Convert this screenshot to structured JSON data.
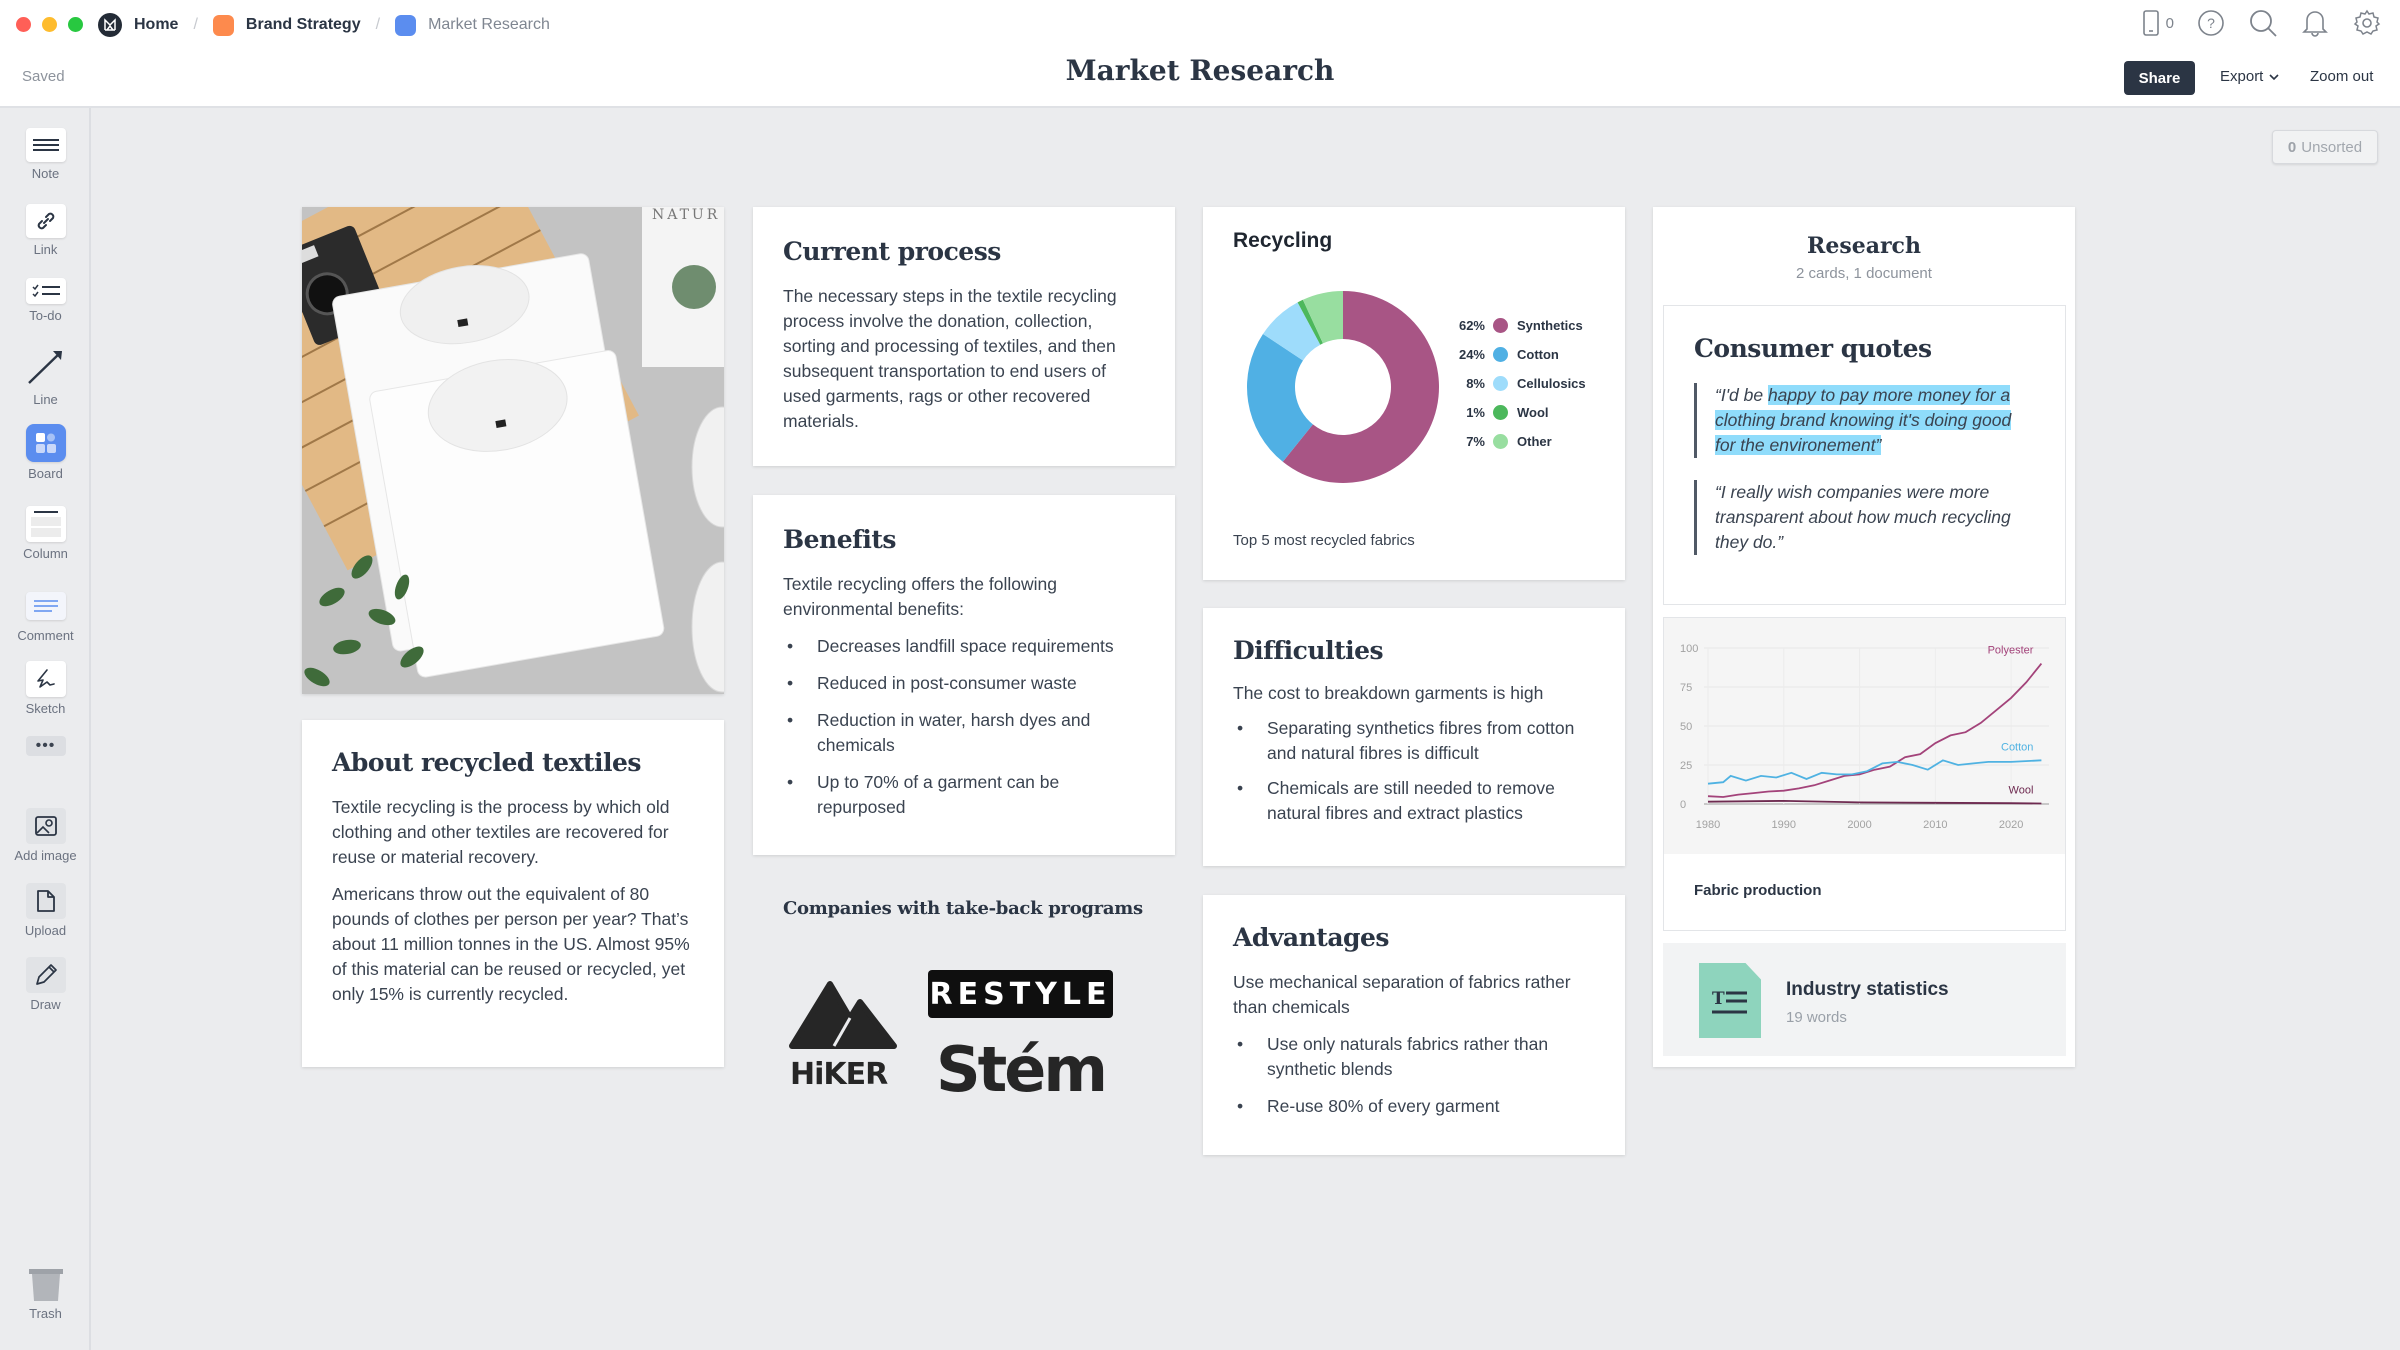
{
  "window": {
    "traffic_lights": {
      "close": "#ff5f57",
      "minimize": "#febc2e",
      "maximize": "#28c840"
    }
  },
  "breadcrumb": [
    {
      "label": "Home",
      "icon": "milanote-logo-icon",
      "color": "#232b36"
    },
    {
      "label": "Brand Strategy",
      "icon": "board-icon",
      "color": "#fd8a4d"
    },
    {
      "label": "Market Research",
      "icon": "board-icon",
      "color": "#5b8def"
    }
  ],
  "header": {
    "status": "Saved",
    "title": "Market Research",
    "device_count": "0",
    "share_label": "Share",
    "export_label": "Export",
    "zoom_label": "Zoom out",
    "icons": [
      "mobile-device-icon",
      "help-icon",
      "search-icon",
      "bell-icon",
      "settings-gear-icon"
    ]
  },
  "sidebar": {
    "tools": [
      {
        "label": "Note",
        "icon": "note-icon"
      },
      {
        "label": "Link",
        "icon": "link-icon"
      },
      {
        "label": "To-do",
        "icon": "todo-icon"
      },
      {
        "label": "Line",
        "icon": "line-arrow-icon"
      },
      {
        "label": "Board",
        "icon": "board-icon"
      },
      {
        "label": "Column",
        "icon": "column-icon"
      },
      {
        "label": "Comment",
        "icon": "comment-icon"
      },
      {
        "label": "Sketch",
        "icon": "sketch-icon"
      },
      {
        "label": "",
        "icon": "more-icon"
      },
      {
        "label": "Add image",
        "icon": "add-image-icon"
      },
      {
        "label": "Upload",
        "icon": "upload-file-icon"
      },
      {
        "label": "Draw",
        "icon": "pen-icon"
      }
    ],
    "trash_label": "Trash"
  },
  "unsorted": {
    "count": "0",
    "label": "Unsorted"
  },
  "cards": {
    "photo": {
      "alt": "Folded white t-shirts with camera, plant and sneakers",
      "magazine_text": "NATUR"
    },
    "about": {
      "title": "About recycled textiles",
      "paragraphs": [
        "Textile recycling is the process by which old clothing and other textiles are recovered for reuse or material recovery.",
        "Americans throw out the equivalent of 80 pounds of clothes per person per year? That’s about 11 million tonnes in the US. Almost 95% of this material can be reused or recycled, yet only 15% is currently recycled."
      ]
    },
    "current_process": {
      "title": "Current process",
      "body": "The necessary steps in the textile recycling process involve the donation, collection, sorting and processing of textiles, and then subsequent transportation to end users of used garments, rags or other recovered materials."
    },
    "benefits": {
      "title": "Benefits",
      "intro": "Textile recycling offers the following environmental benefits:",
      "items": [
        "Decreases landfill space requirements",
        "Reduced in post-consumer waste",
        "Reduction in water, harsh dyes and chemicals",
        "Up to 70% of a garment can be repurposed"
      ]
    },
    "companies": {
      "title": "Companies with take-back programs",
      "logos": [
        "HiKER",
        "RESTYLE",
        "Stém"
      ]
    },
    "difficulties": {
      "title": "Difficulties",
      "intro": "The cost to breakdown garments is high",
      "items": [
        "Separating synthetics fibres from cotton and natural fibres is difficult",
        "Chemicals are still needed to remove natural fibres and extract plastics"
      ]
    },
    "advantages": {
      "title": "Advantages",
      "intro": "Use mechanical separation of fabrics rather than chemicals",
      "items": [
        "Use only naturals fabrics rather than synthetic blends",
        "Re-use 80% of every garment"
      ]
    },
    "research": {
      "title": "Research",
      "subtitle": "2 cards, 1 document",
      "quotes_title": "Consumer quotes",
      "quote1_pre": "“I'd be ",
      "quote1_highlight": "happy to pay more money for a clothing brand knowing it's doing good for the environement”",
      "quote2": "“I really wish companies were more transparent about how much recycling they do.”",
      "line_chart_caption": "Fabric production",
      "document": {
        "title": "Industry statistics",
        "meta": "19 words"
      }
    }
  },
  "chart_data": [
    {
      "type": "pie",
      "title": "Recycling",
      "caption": "Top 5 most recycled fabrics",
      "donut": true,
      "legend_position": "right",
      "slices": [
        {
          "label": "Synthetics",
          "value": 62,
          "display": "62%",
          "color": "#a85585"
        },
        {
          "label": "Cotton",
          "value": 24,
          "display": "24%",
          "color": "#50b0e4"
        },
        {
          "label": "Cellulosics",
          "value": 8,
          "display": "8%",
          "color": "#9edcfb"
        },
        {
          "label": "Wool",
          "value": 1,
          "display": "1%",
          "color": "#4cb85c"
        },
        {
          "label": "Other",
          "value": 7,
          "display": "7%",
          "color": "#98dea0"
        }
      ]
    },
    {
      "type": "line",
      "title": "Fabric production",
      "xlabel": "",
      "ylabel": "",
      "xlim": [
        1980,
        2025
      ],
      "ylim": [
        0,
        100
      ],
      "xticks": [
        1980,
        1990,
        2000,
        2010,
        2020
      ],
      "yticks": [
        0,
        25,
        50,
        75,
        100
      ],
      "grid": true,
      "series": [
        {
          "name": "Polyester",
          "color": "#a3437a",
          "x": [
            1980,
            1982,
            1984,
            1986,
            1988,
            1990,
            1992,
            1994,
            1996,
            1998,
            2000,
            2002,
            2004,
            2006,
            2008,
            2010,
            2012,
            2014,
            2016,
            2018,
            2020,
            2022,
            2024
          ],
          "y": [
            5,
            4.5,
            6,
            7,
            8,
            8.5,
            10,
            12,
            15,
            18,
            19,
            22,
            24,
            30,
            32,
            39,
            44,
            46,
            52,
            60,
            68,
            78,
            90
          ]
        },
        {
          "name": "Cotton",
          "color": "#4fb2e2",
          "x": [
            1980,
            1982,
            1983,
            1985,
            1987,
            1989,
            1991,
            1993,
            1995,
            1997,
            1999,
            2001,
            2003,
            2005,
            2007,
            2009,
            2011,
            2013,
            2015,
            2017,
            2020,
            2024
          ],
          "y": [
            13,
            14,
            18,
            15,
            18,
            17,
            20,
            16,
            20,
            19,
            19,
            21,
            26,
            27,
            25,
            22,
            28,
            25,
            26,
            27,
            27,
            28
          ]
        },
        {
          "name": "Wool",
          "color": "#6e2a50",
          "x": [
            1980,
            1990,
            2000,
            2010,
            2020,
            2024
          ],
          "y": [
            1.5,
            2,
            1,
            0.8,
            0.5,
            0.3
          ]
        }
      ]
    }
  ]
}
